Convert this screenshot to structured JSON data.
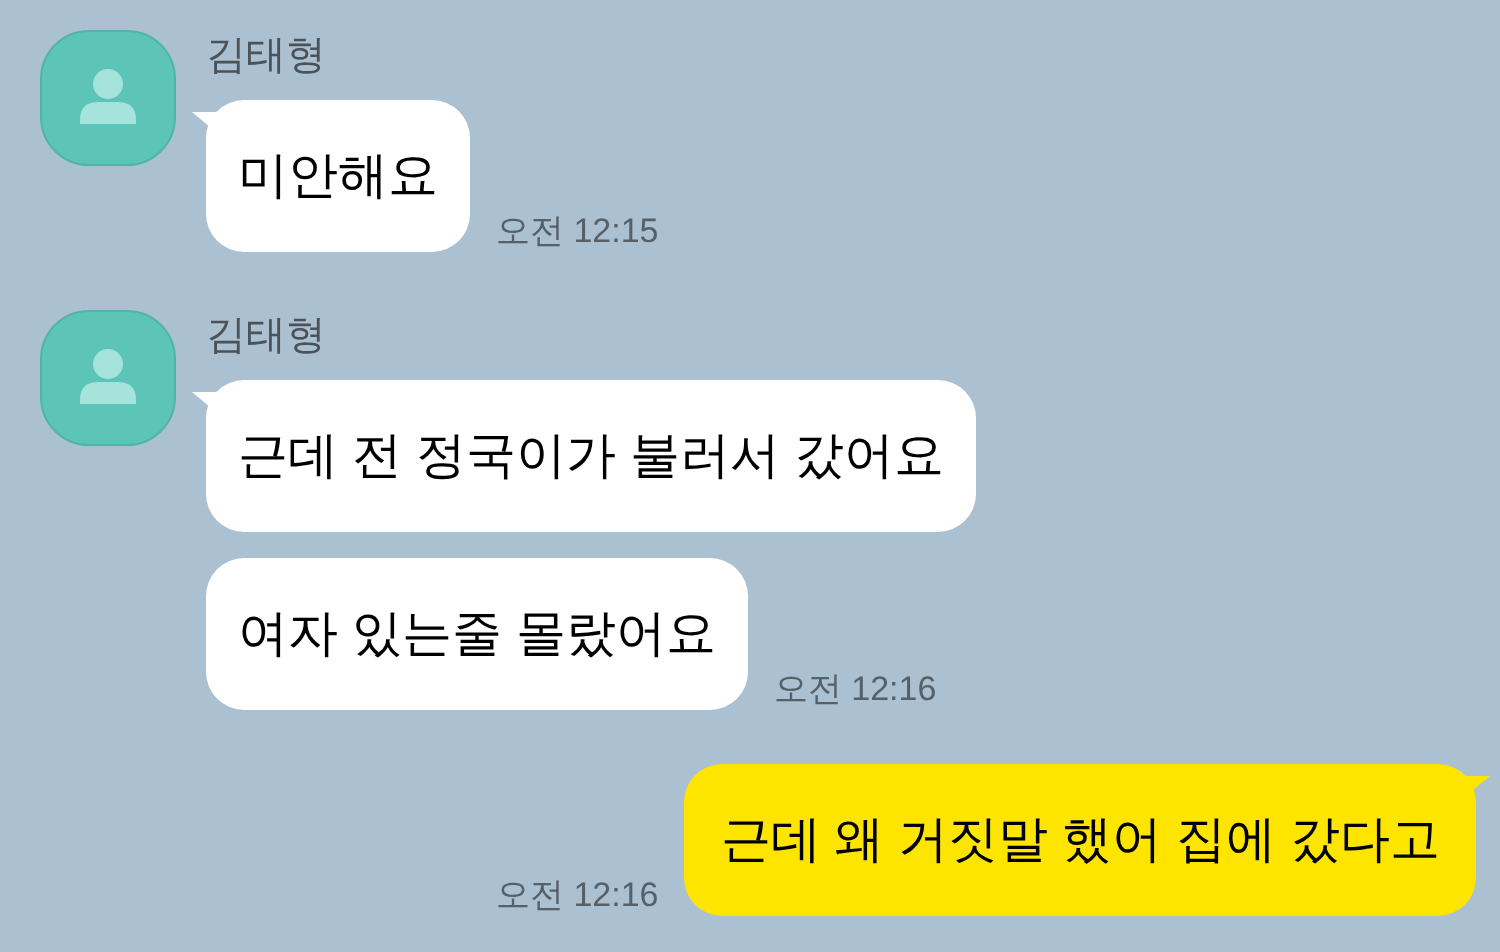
{
  "messages": [
    {
      "kind": "received",
      "sender": "김태형",
      "bubbles": [
        {
          "text": "미안해요",
          "time": "오전 12:15"
        }
      ]
    },
    {
      "kind": "received",
      "sender": "김태형",
      "bubbles": [
        {
          "text": "근데 전 정국이가 불러서 갔어요"
        },
        {
          "text": "여자 있는줄 몰랐어요",
          "time": "오전 12:16"
        }
      ]
    },
    {
      "kind": "sent",
      "bubbles": [
        {
          "text": "근데 왜 거짓말 했어 집에 갔다고",
          "time": "오전 12:16"
        }
      ]
    }
  ]
}
